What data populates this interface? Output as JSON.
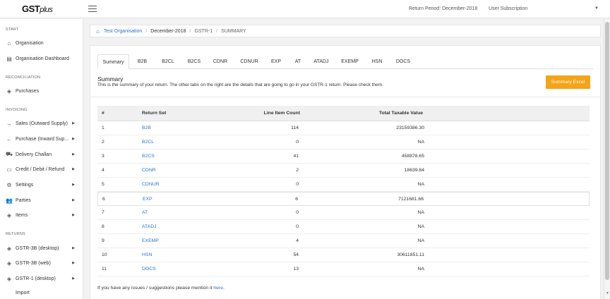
{
  "app": {
    "logo_main": "GST",
    "logo_sub": "plus"
  },
  "topbar": {
    "return_period": "Return Period: December-2018",
    "user_menu": "User Subscription"
  },
  "sidebar": {
    "sections": {
      "start": "START",
      "reconciliation": "RECONCILIATION",
      "invoicing": "INVOICING",
      "returns": "RETURNS"
    },
    "items": [
      {
        "label": "Organisation",
        "icon": "home-icon"
      },
      {
        "label": "Organisation Dashboard",
        "icon": "dashboard-icon"
      },
      {
        "label": "Purchases",
        "icon": "layers-icon"
      },
      {
        "label": "Sales (Outward Supply)",
        "icon": "arrow-right-icon"
      },
      {
        "label": "Purchase (Inward Sup...",
        "icon": "arrow-left-icon"
      },
      {
        "label": "Delivery Challan",
        "icon": "truck-icon"
      },
      {
        "label": "Credit / Debit / Refund",
        "icon": "card-icon"
      },
      {
        "label": "Settings",
        "icon": "gear-icon"
      },
      {
        "label": "Parties",
        "icon": "users-icon"
      },
      {
        "label": "Items",
        "icon": "layers-icon"
      },
      {
        "label": "GSTR-3B (desktop)",
        "icon": "layers-icon"
      },
      {
        "label": "GSTR-3B (web)",
        "icon": "layers-icon"
      },
      {
        "label": "GSTR-1 (desktop)",
        "icon": "layers-icon"
      },
      {
        "label": "Import",
        "icon": ""
      }
    ]
  },
  "breadcrumb": {
    "org": "Test Organisation",
    "period": "December-2018",
    "return": "GSTR-1",
    "current": "SUMMARY"
  },
  "tabs": [
    "Summary",
    "B2B",
    "B2CL",
    "B2CS",
    "CDNR",
    "CDNUR",
    "EXP",
    "AT",
    "ATADJ",
    "EXEMP",
    "HSN",
    "DOCS"
  ],
  "summary": {
    "title": "Summary",
    "description": "This is the summary of your return. The other tabs on the right are the details that are going to go in your GSTR-1 return. Please check them.",
    "excel_button": "Summary Excel"
  },
  "table": {
    "headers": {
      "num": "#",
      "set": "Return Set",
      "count": "Line Item Count",
      "value": "Total Taxable Value"
    },
    "rows": [
      {
        "num": "1",
        "set": "B2B",
        "count": "114",
        "value": "23159386.30"
      },
      {
        "num": "2",
        "set": "B2CL",
        "count": "0",
        "value": "NA"
      },
      {
        "num": "3",
        "set": "B2CS",
        "count": "41",
        "value": "458878.65"
      },
      {
        "num": "4",
        "set": "CDNR",
        "count": "2",
        "value": "18639.84"
      },
      {
        "num": "5",
        "set": "CDNUR",
        "count": "0",
        "value": "NA"
      },
      {
        "num": "6",
        "set": "EXP",
        "count": "6",
        "value": "7121681.66"
      },
      {
        "num": "7",
        "set": "AT",
        "count": "0",
        "value": "NA"
      },
      {
        "num": "8",
        "set": "ATADJ",
        "count": "0",
        "value": "NA"
      },
      {
        "num": "9",
        "set": "EXEMP",
        "count": "4",
        "value": "NA"
      },
      {
        "num": "10",
        "set": "HSN",
        "count": "54",
        "value": "30611851.11"
      },
      {
        "num": "11",
        "set": "DOCS",
        "count": "13",
        "value": "NA"
      }
    ]
  },
  "footer": {
    "text": "If you have any issues / suggestions please mention it ",
    "link": "here",
    "end": "."
  },
  "colors": {
    "accent": "#2a76c6",
    "button": "#f4a418"
  }
}
